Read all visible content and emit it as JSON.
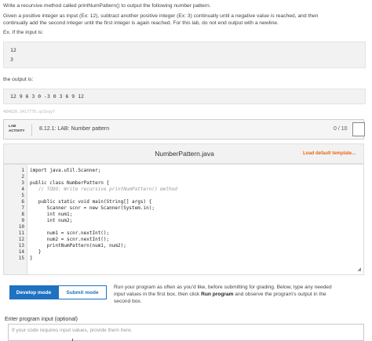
{
  "problem": {
    "line1": "Write a recursive method called printNumPattern() to output the following number pattern.",
    "line2": "Given a positive integer as input (Ex: 12), subtract another positive integer (Ex: 3) continually until a negative value is reached, and then",
    "line3": "continually add the second integer until the first integer is again reached. For this lab, do not end output with a newline.",
    "line4": "Ex. If the input is:",
    "input_lines": [
      "12",
      "3"
    ],
    "output_label": "the output is:",
    "output_line": "12 9 6 3 0 -3 0 3 6 9 12",
    "hash": "484820.3417778.qx3zqy7"
  },
  "activity": {
    "badge_line1": "LAB",
    "badge_line2": "ACTIVITY",
    "title": "8.12.1: LAB: Number pattern",
    "score": "0 / 10"
  },
  "editor": {
    "filename": "NumberPattern.java",
    "load_default": "Load default template...",
    "lines": [
      "import java.util.Scanner;",
      "",
      "public class NumberPattern {",
      "   // TODO: Write recursive printNumPattern() method",
      "",
      "   public static void main(String[] args) {",
      "      Scanner scnr = new Scanner(System.in);",
      "      int num1;",
      "      int num2;",
      "",
      "      num1 = scnr.nextInt();",
      "      num2 = scnr.nextInt();",
      "      printNumPattern(num1, num2);",
      "   }",
      "}"
    ],
    "line_numbers": [
      "1",
      "2",
      "3",
      "4",
      "5",
      "6",
      "7",
      "8",
      "9",
      "10",
      "11",
      "12",
      "13",
      "14",
      "15"
    ]
  },
  "controls": {
    "develop_mode": "Develop mode",
    "submit_mode": "Submit mode",
    "run_text_1": "Run your program as often as you'd like, before submitting for grading. Below, type any needed",
    "run_text_2a": "input values in the first box, then click ",
    "run_text_2b": "Run program",
    "run_text_2c": " and observe the program's output in the",
    "run_text_3": "second box."
  },
  "program_input": {
    "label": "Enter program input (optional)",
    "placeholder": "If your code requires input values, provide them here."
  },
  "colors": {
    "accent": "#1f72c2",
    "load_default": "#e66b14"
  }
}
